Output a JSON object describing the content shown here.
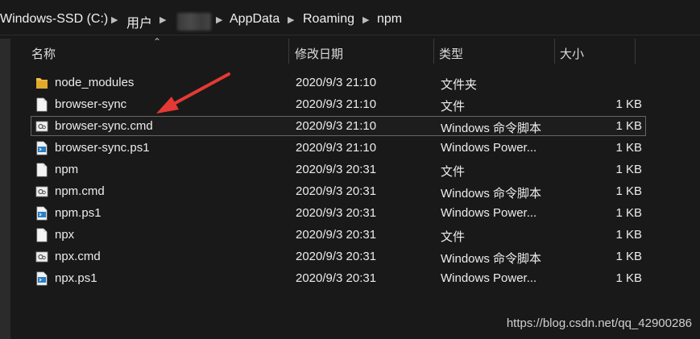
{
  "breadcrumb": {
    "items": [
      "Windows-SSD (C:)",
      "用户",
      "AppData",
      "Roaming",
      "npm"
    ]
  },
  "columns": {
    "name": "名称",
    "date": "修改日期",
    "type": "类型",
    "size": "大小"
  },
  "files": [
    {
      "name": "node_modules",
      "date": "2020/9/3 21:10",
      "type": "文件夹",
      "size": "",
      "icon": "folder-icon"
    },
    {
      "name": "browser-sync",
      "date": "2020/9/3 21:10",
      "type": "文件",
      "size": "1 KB",
      "icon": "file-icon"
    },
    {
      "name": "browser-sync.cmd",
      "date": "2020/9/3 21:10",
      "type": "Windows 命令脚本",
      "size": "1 KB",
      "icon": "cmd-script-icon"
    },
    {
      "name": "browser-sync.ps1",
      "date": "2020/9/3 21:10",
      "type": "Windows Power...",
      "size": "1 KB",
      "icon": "powershell-script-icon"
    },
    {
      "name": "npm",
      "date": "2020/9/3 20:31",
      "type": "文件",
      "size": "1 KB",
      "icon": "file-icon"
    },
    {
      "name": "npm.cmd",
      "date": "2020/9/3 20:31",
      "type": "Windows 命令脚本",
      "size": "1 KB",
      "icon": "cmd-script-icon"
    },
    {
      "name": "npm.ps1",
      "date": "2020/9/3 20:31",
      "type": "Windows Power...",
      "size": "1 KB",
      "icon": "powershell-script-icon"
    },
    {
      "name": "npx",
      "date": "2020/9/3 20:31",
      "type": "文件",
      "size": "1 KB",
      "icon": "file-icon"
    },
    {
      "name": "npx.cmd",
      "date": "2020/9/3 20:31",
      "type": "Windows 命令脚本",
      "size": "1 KB",
      "icon": "cmd-script-icon"
    },
    {
      "name": "npx.ps1",
      "date": "2020/9/3 20:31",
      "type": "Windows Power...",
      "size": "1 KB",
      "icon": "powershell-script-icon"
    }
  ],
  "selected_file": "browser-sync.cmd",
  "watermark": "https://blog.csdn.net/qq_42900286",
  "colors": {
    "background": "#191919",
    "annotation_arrow": "#e53935",
    "folder": "#f2c14e"
  }
}
